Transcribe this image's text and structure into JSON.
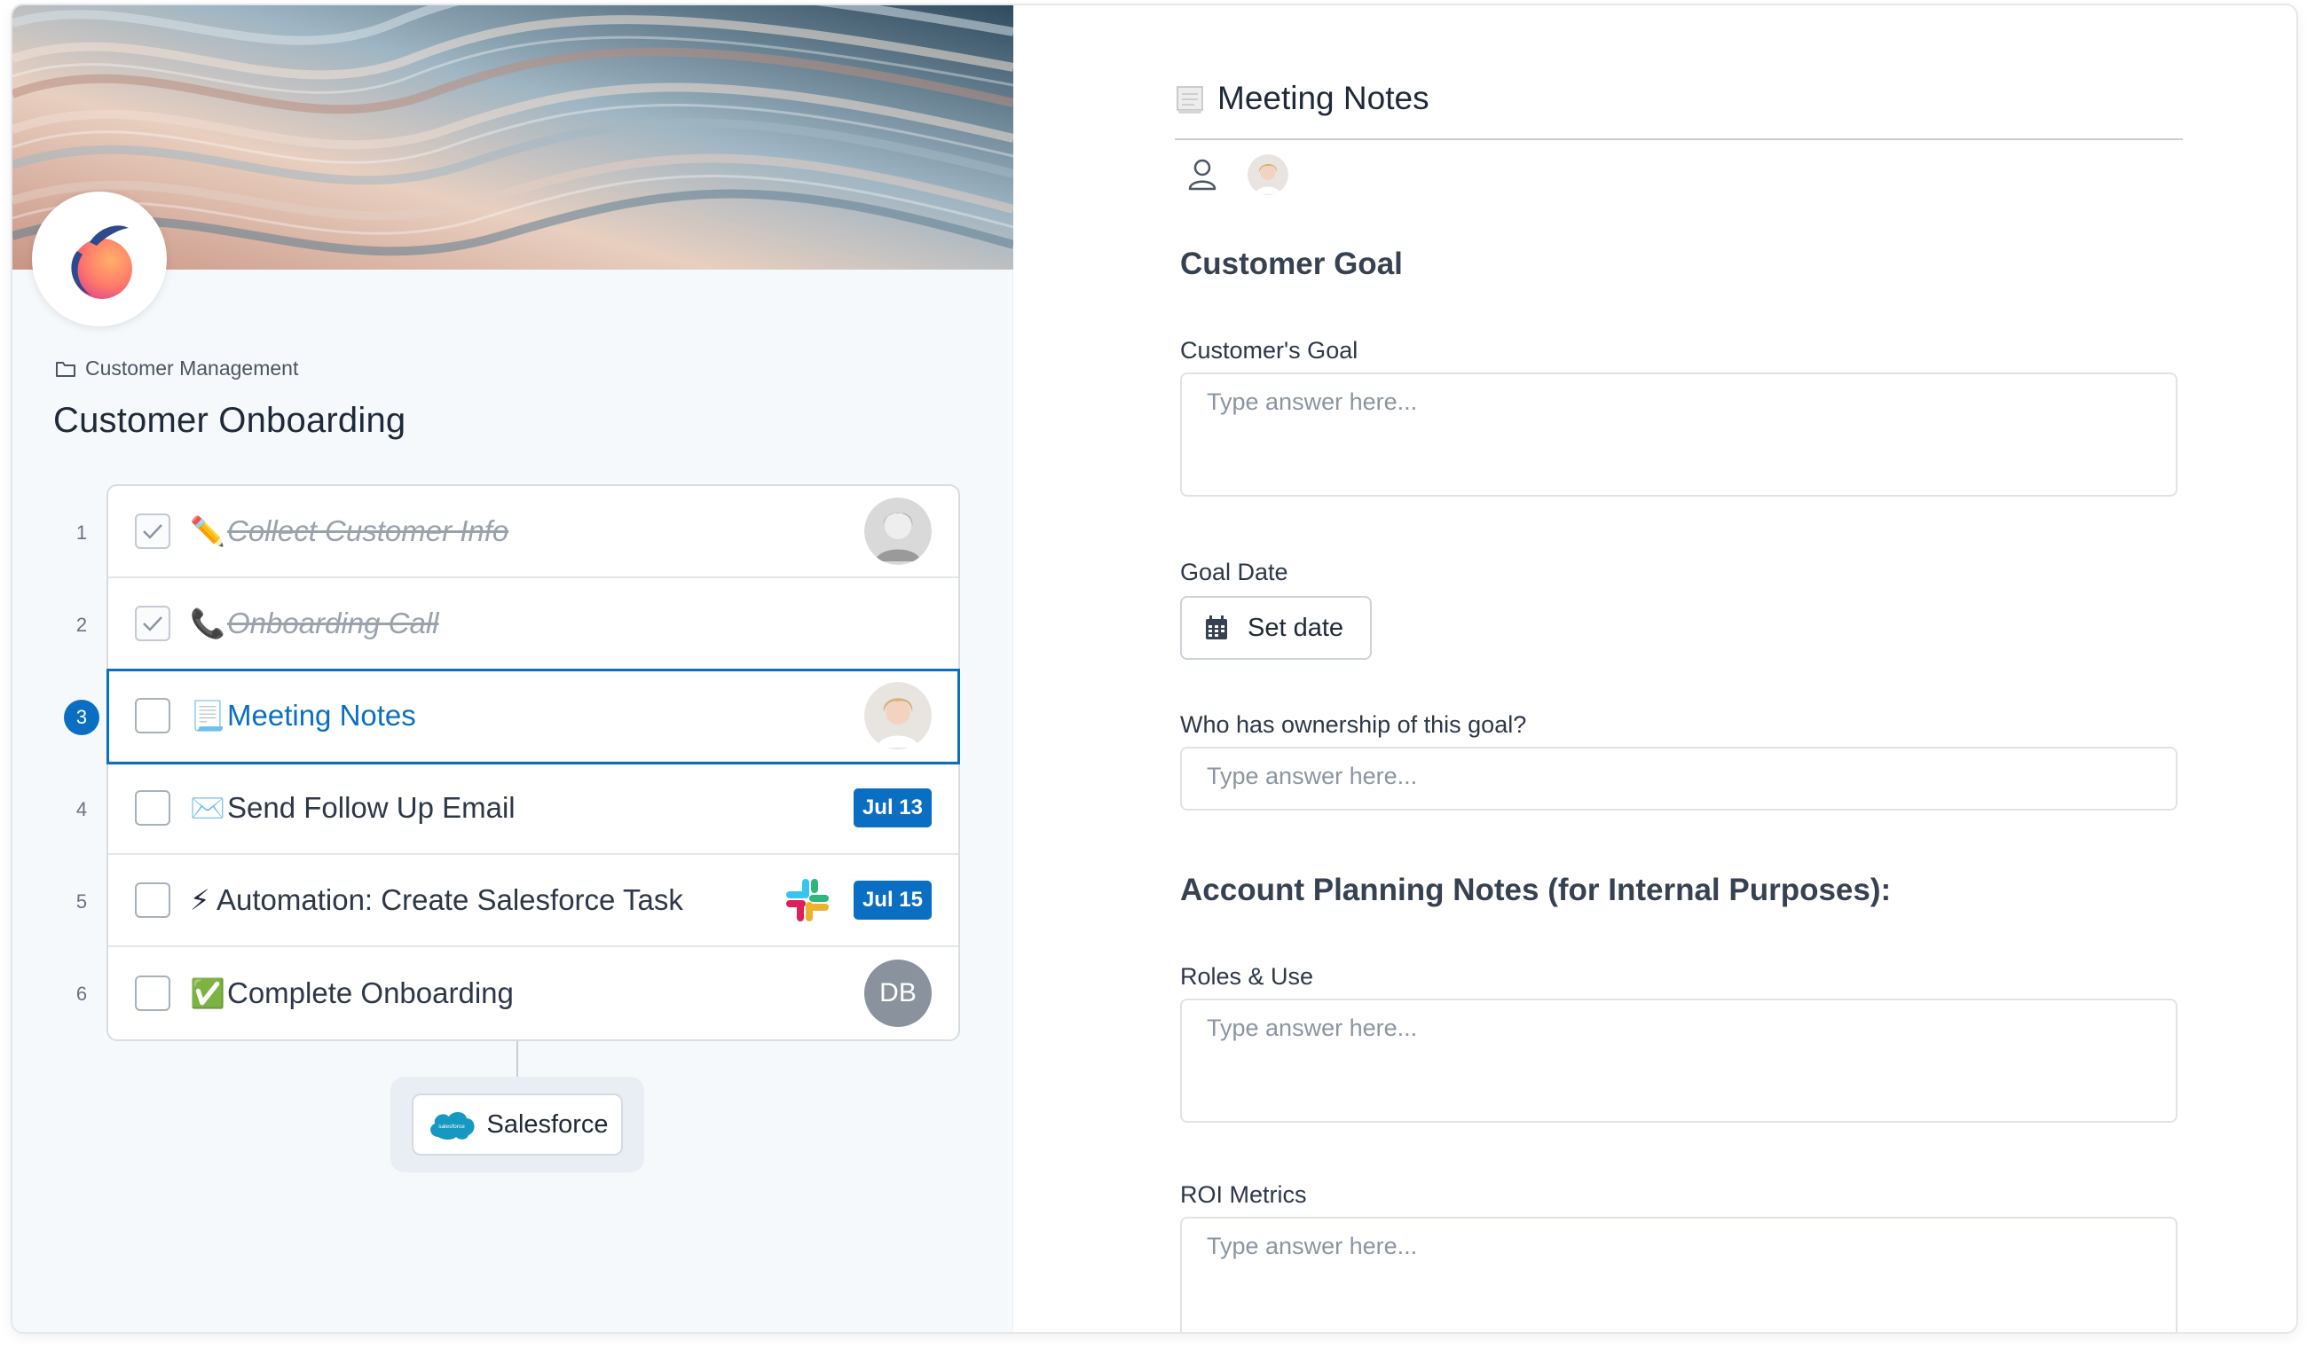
{
  "left": {
    "breadcrumb": "Customer Management",
    "title": "Customer Onboarding",
    "tasks": [
      {
        "number": "1",
        "label": "Collect Customer Info",
        "emoji": "✏️",
        "done": true
      },
      {
        "number": "2",
        "label": "Onboarding Call",
        "emoji": "📞",
        "done": true
      },
      {
        "number": "3",
        "label": "Meeting Notes",
        "emoji": "📃",
        "done": false
      },
      {
        "number": "4",
        "label": "Send Follow Up Email",
        "emoji": "✉️",
        "done": false,
        "badge": "Jul 13"
      },
      {
        "number": "5",
        "label": "Automation: Create Salesforce Task",
        "emoji": "⚡",
        "done": false,
        "badge": "Jul 15"
      },
      {
        "number": "6",
        "label": "Complete Onboarding",
        "emoji": "✅",
        "done": false,
        "avatar_initials": "DB"
      }
    ],
    "integration": {
      "label": "Salesforce",
      "logo_text": "salesforce"
    }
  },
  "right": {
    "title": "Meeting Notes",
    "section1": "Customer Goal",
    "field_goal": {
      "label": "Customer's Goal",
      "placeholder": "Type answer here..."
    },
    "field_date": {
      "label": "Goal Date",
      "button": "Set date"
    },
    "field_owner": {
      "label": "Who has ownership of this goal?",
      "placeholder": "Type answer here..."
    },
    "section2": "Account Planning Notes (for Internal Purposes):",
    "field_roles": {
      "label": "Roles & Use",
      "placeholder": "Type answer here..."
    },
    "field_roi": {
      "label": "ROI Metrics",
      "placeholder": "Type answer here..."
    }
  },
  "colors": {
    "accent": "#0a6fc2",
    "badge": "#0a6fc2"
  }
}
